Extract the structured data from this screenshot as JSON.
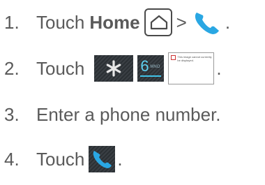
{
  "steps": [
    {
      "number": "1.",
      "text": "Touch",
      "bold": "Home",
      "separator": ">",
      "end": "."
    },
    {
      "number": "2.",
      "text": "Touch",
      "key_six_digit": "6",
      "key_six_letters": "MNO",
      "broken_image_text": "This image cannot currently be displayed.",
      "end": "."
    },
    {
      "number": "3.",
      "text": "Enter a phone number."
    },
    {
      "number": "4.",
      "text": "Touch",
      "end": "."
    }
  ],
  "icons": {
    "home": "home-icon",
    "phone": "phone-icon",
    "star": "asterisk-key-icon",
    "broken": "broken-image-icon"
  },
  "colors": {
    "text": "#5a5a5a",
    "phone_blue": "#2aa7e3",
    "key_bg": "#2f3438",
    "key_accent": "#41c3e8"
  }
}
